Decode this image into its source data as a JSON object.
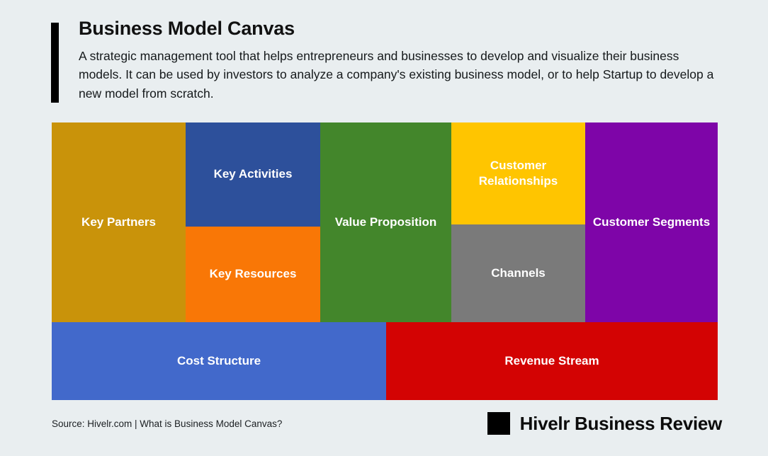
{
  "header": {
    "title": "Business Model Canvas",
    "description": "A strategic management tool that helps entrepreneurs and businesses to develop and visualize their business models. It can be used by investors to analyze a company's existing business model, or to help Startup to develop a new model from scratch."
  },
  "chart_data": {
    "type": "table",
    "title": "Business Model Canvas",
    "layout": "9-block business model canvas grid",
    "blocks": [
      {
        "key": "key_partners",
        "label": "Key Partners",
        "color": "#c9930a",
        "column": 1,
        "row": "full"
      },
      {
        "key": "key_activities",
        "label": "Key Activities",
        "color": "#2d509b",
        "column": 2,
        "row": "top"
      },
      {
        "key": "key_resources",
        "label": "Key Resources",
        "color": "#f97706",
        "column": 2,
        "row": "bottom"
      },
      {
        "key": "value_proposition",
        "label": "Value Proposition",
        "color": "#43862b",
        "column": 3,
        "row": "full"
      },
      {
        "key": "customer_relationships",
        "label": "Customer Relationships",
        "color": "#ffc500",
        "column": 4,
        "row": "top"
      },
      {
        "key": "channels",
        "label": "Channels",
        "color": "#7a7a7a",
        "column": 4,
        "row": "bottom"
      },
      {
        "key": "customer_segments",
        "label": "Customer Segments",
        "color": "#7e05a8",
        "column": 5,
        "row": "full"
      },
      {
        "key": "cost_structure",
        "label": "Cost Structure",
        "color": "#4269cb",
        "column": "1-3",
        "row": "footer"
      },
      {
        "key": "revenue_stream",
        "label": "Revenue Stream",
        "color": "#d30303",
        "column": "4-5",
        "row": "footer"
      }
    ]
  },
  "canvas": {
    "key_partners": "Key Partners",
    "key_activities": "Key Activities",
    "key_resources": "Key Resources",
    "value_proposition": "Value Proposition",
    "customer_relationships": "Customer Relationships",
    "channels": "Channels",
    "customer_segments": "Customer Segments",
    "cost_structure": "Cost Structure",
    "revenue_stream": "Revenue Stream"
  },
  "footer": {
    "source": "Source: Hivelr.com | What is Business Model Canvas?",
    "brand_name": "Hivelr Business Review"
  },
  "colors": {
    "background": "#e9eef0",
    "key_partners": "#c9930a",
    "key_activities": "#2d509b",
    "key_resources": "#f97706",
    "value_proposition": "#43862b",
    "customer_relationships": "#ffc500",
    "channels": "#7a7a7a",
    "customer_segments": "#7e05a8",
    "cost_structure": "#4269cb",
    "revenue_stream": "#d30303",
    "accent": "#000000"
  }
}
